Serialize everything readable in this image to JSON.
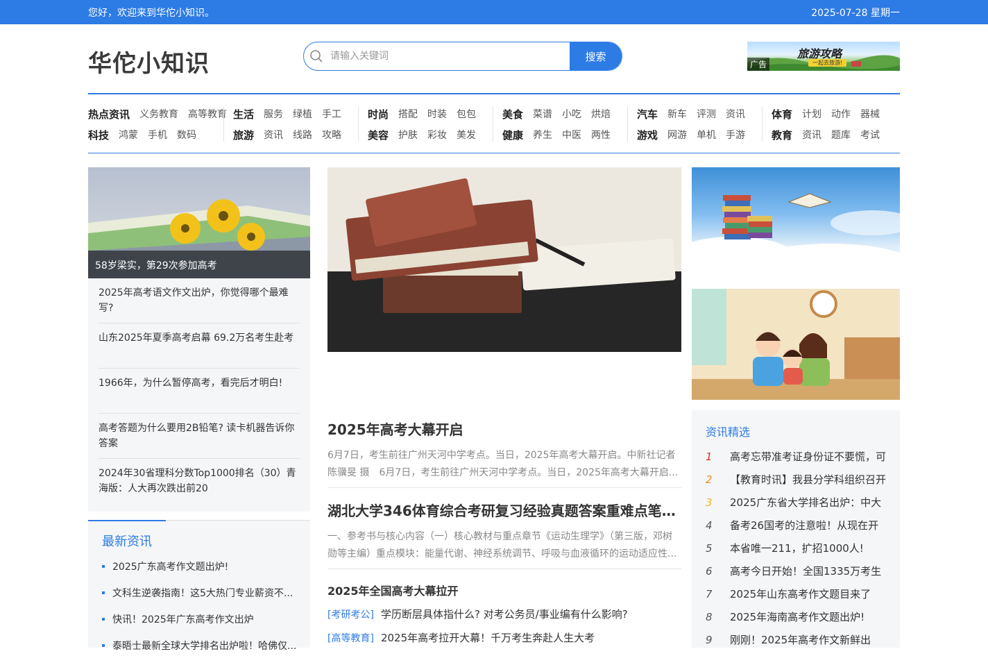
{
  "topbar": {
    "welcome": "您好，欢迎来到华佗小知识。",
    "date": "2025-07-28 星期一"
  },
  "header": {
    "logo": "华佗小知识",
    "search_placeholder": "请输入关键词",
    "search_button": "搜索",
    "ad": {
      "title": "旅游攻略",
      "subtitle": "一起去旅游!",
      "tag": "广告"
    }
  },
  "nav": [
    {
      "rows": [
        {
          "cat": "热点资讯",
          "subs": [
            "义务教育",
            "高等教育"
          ]
        },
        {
          "cat": "科技",
          "subs": [
            "鸿蒙",
            "手机",
            "数码"
          ]
        }
      ]
    },
    {
      "rows": [
        {
          "cat": "生活",
          "subs": [
            "服务",
            "绿植",
            "手工"
          ]
        },
        {
          "cat": "旅游",
          "subs": [
            "资讯",
            "线路",
            "攻略"
          ]
        }
      ]
    },
    {
      "rows": [
        {
          "cat": "时尚",
          "subs": [
            "搭配",
            "时装",
            "包包"
          ]
        },
        {
          "cat": "美容",
          "subs": [
            "护肤",
            "彩妆",
            "美发"
          ]
        }
      ]
    },
    {
      "rows": [
        {
          "cat": "美食",
          "subs": [
            "菜谱",
            "小吃",
            "烘焙"
          ]
        },
        {
          "cat": "健康",
          "subs": [
            "养生",
            "中医",
            "两性"
          ]
        }
      ]
    },
    {
      "rows": [
        {
          "cat": "汽车",
          "subs": [
            "新车",
            "评测",
            "资讯"
          ]
        },
        {
          "cat": "游戏",
          "subs": [
            "网游",
            "单机",
            "手游"
          ]
        }
      ]
    },
    {
      "rows": [
        {
          "cat": "体育",
          "subs": [
            "计划",
            "动作",
            "器械"
          ]
        },
        {
          "cat": "教育",
          "subs": [
            "资讯",
            "题库",
            "考试"
          ]
        }
      ]
    }
  ],
  "left": {
    "feature_caption": "58岁梁实，第29次参加高考",
    "items": [
      "2025年高考语文作文出炉，你觉得哪个最难写?",
      "山东2025年夏季高考启幕 69.2万名考生赴考",
      "1966年，为什么暂停高考，看完后才明白!",
      "高考答题为什么要用2B铅笔? 读卡机器告诉你答案",
      "2024年30省理科分数Top1000排名（30）青海版：人大再次跌出前20"
    ],
    "latest_title": "最新资讯",
    "latest": [
      "2025广东高考作文题出炉!",
      "文科生逆袭指南！这5大热门专业薪资不...",
      "快讯！2025年广东高考作文出炉",
      "泰晤士最新全球大学排名出炉啦！哈佛仅..."
    ]
  },
  "center": {
    "articles": [
      {
        "title": "2025年高考大幕开启",
        "desc": "6月7日，考生前往广州天河中学考点。当日，2025年高考大幕开启。中新社记者 陈骥旻 摄　6月7日，考生前往广州天河中学考点。当日，2025年高考大幕开启..."
      },
      {
        "title": "湖北大学346体育综合考研复习经验真题答案重难点笔记...",
        "desc": "一、参考书与核心内容（一）核心教材与重点章节《运动生理学》（第三版，邓树勋等主编）重点模块：能量代谢、神经系统调节、呼吸与血液循环的运动适应性..."
      }
    ],
    "sub_head": "2025年全国高考大幕拉开",
    "taglines": [
      {
        "tag": "[考研考公]",
        "text": "学历断层具体指什么? 对考公务员/事业编有什么影响?"
      },
      {
        "tag": "[高等教育]",
        "text": "2025年高考拉开大幕！千万考生奔赴人生大考"
      }
    ]
  },
  "right": {
    "picks_title": "资讯精选",
    "picks": [
      {
        "num": "1",
        "text": "高考忘带准考证身份证不要慌，可"
      },
      {
        "num": "2",
        "text": "【教育时讯】我县分学科组织召开"
      },
      {
        "num": "3",
        "text": "2025广东省大学排名出炉：中大"
      },
      {
        "num": "4",
        "text": "备考26国考的注意啦！从现在开"
      },
      {
        "num": "5",
        "text": "本省唯一211，扩招1000人!"
      },
      {
        "num": "6",
        "text": "高考今日开始！全国1335万考生"
      },
      {
        "num": "7",
        "text": "2025年山东高考作文题目来了"
      },
      {
        "num": "8",
        "text": "2025年海南高考作文题出炉!"
      },
      {
        "num": "9",
        "text": "刚刚！2025年高考作文新鲜出"
      }
    ],
    "num_colors": [
      "#d9302b",
      "#f08a24",
      "#f0b92a",
      "#555555"
    ]
  },
  "colors": {
    "brand": "#2d7be5"
  }
}
